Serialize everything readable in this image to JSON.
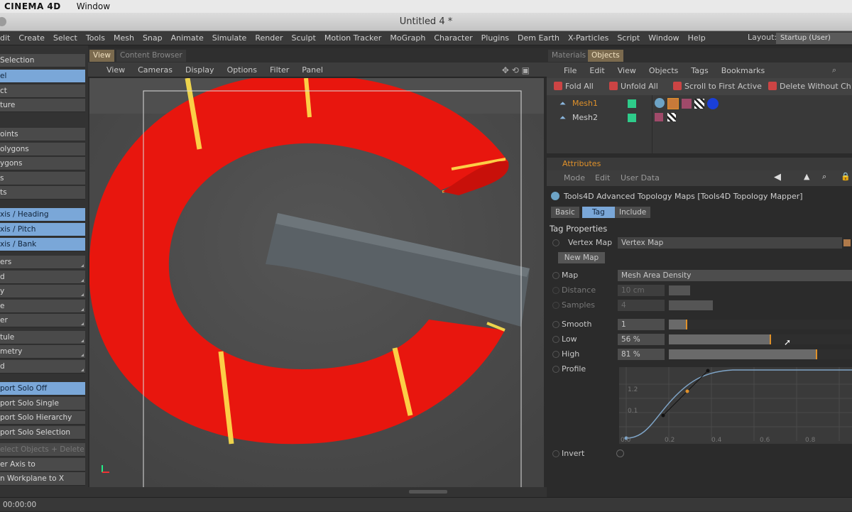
{
  "macbar": {
    "app": "CINEMA 4D",
    "window": "Window"
  },
  "titlebar": {
    "title": "Untitled 4 *"
  },
  "mainmenu": {
    "items": [
      "dit",
      "Create",
      "Select",
      "Tools",
      "Mesh",
      "Snap",
      "Animate",
      "Simulate",
      "Render",
      "Sculpt",
      "Motion Tracker",
      "MoGraph",
      "Character",
      "Plugins",
      "Dem Earth",
      "X-Particles",
      "Script",
      "Window",
      "Help"
    ],
    "layout_label": "Layout:",
    "layout_value": "Startup (User)"
  },
  "left_panel": {
    "items": [
      {
        "label": "Selection",
        "sel": false
      },
      {
        "label": "el",
        "sel": true
      },
      {
        "label": "ct",
        "sel": false
      },
      {
        "label": "ture",
        "sel": false
      },
      {
        "label": "oints",
        "sel": false
      },
      {
        "label": "olygons",
        "sel": false
      },
      {
        "label": "ygons",
        "sel": false
      },
      {
        "label": "s",
        "sel": false
      },
      {
        "label": "ts",
        "sel": false
      },
      {
        "label": "xis / Heading",
        "sel": true
      },
      {
        "label": "xis / Pitch",
        "sel": true
      },
      {
        "label": "xis / Bank",
        "sel": true
      },
      {
        "label": "ers",
        "sel": false
      },
      {
        "label": "d",
        "sel": false
      },
      {
        "label": "y",
        "sel": false
      },
      {
        "label": "e",
        "sel": false
      },
      {
        "label": "er",
        "sel": false
      },
      {
        "label": "tule",
        "sel": false
      },
      {
        "label": "metry",
        "sel": false
      },
      {
        "label": "d",
        "sel": false
      },
      {
        "label": "port Solo Off",
        "sel": true
      },
      {
        "label": "port Solo Single",
        "sel": false
      },
      {
        "label": "port Solo Hierarchy",
        "sel": false
      },
      {
        "label": "port Solo Selection",
        "sel": false
      },
      {
        "label": "elect Objects + Delete",
        "sel": false
      },
      {
        "label": "er Axis to",
        "sel": false
      },
      {
        "label": "n Workplane to X",
        "sel": false
      }
    ]
  },
  "viewport": {
    "tabs": [
      "View",
      "Content Browser"
    ],
    "menu": [
      "View",
      "Cameras",
      "Display",
      "Options",
      "Filter",
      "Panel"
    ]
  },
  "right_tabs": [
    "Materials",
    "Objects"
  ],
  "objects": {
    "menu": [
      "File",
      "Edit",
      "View",
      "Objects",
      "Tags",
      "Bookmarks"
    ],
    "toolbar": [
      "Fold All",
      "Unfold All",
      "Scroll to First Active",
      "Delete Without Ch"
    ],
    "rows": [
      {
        "name": "Mesh1",
        "active": true
      },
      {
        "name": "Mesh2",
        "active": false
      }
    ]
  },
  "attributes": {
    "header": "Attributes",
    "menu": [
      "Mode",
      "Edit",
      "User Data"
    ],
    "title": "Tools4D Advanced Topology Maps [Tools4D Topology Mapper]",
    "tabs": [
      "Basic",
      "Tag",
      "Include"
    ],
    "selected_tab": "Tag",
    "section": "Tag Properties",
    "vertex_map_label": "Vertex Map",
    "vertex_map_value": "Vertex Map",
    "new_map_button": "New Map",
    "map_label": "Map",
    "map_value": "Mesh Area Density",
    "distance_label": "Distance",
    "distance_value": "10 cm",
    "samples_label": "Samples",
    "samples_value": "4",
    "smooth_label": "Smooth",
    "smooth_value": "1",
    "smooth_level": 0.1,
    "low_label": "Low",
    "low_value": "56 %",
    "low_level": 0.56,
    "high_label": "High",
    "high_value": "81 %",
    "high_level": 0.81,
    "profile_label": "Profile",
    "invert_label": "Invert",
    "graph_ticks_y": [
      "1.2",
      "0.1"
    ],
    "graph_ticks_x": [
      "0.2",
      "0.4",
      "0.6",
      "0.8"
    ],
    "graph_origin": "0.0"
  },
  "status": {
    "time": "00:00:00"
  },
  "colors": {
    "accent": "#e0912a",
    "selection": "#7aa7d8",
    "object_red": "#e8160e"
  }
}
